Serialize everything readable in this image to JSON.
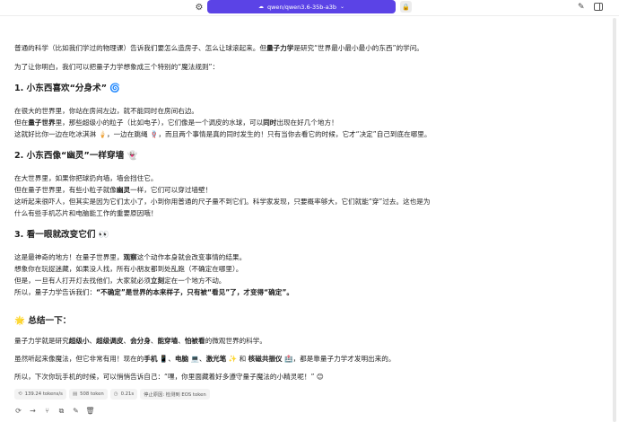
{
  "topbar": {
    "model_name": "qwen/qwen3.6-35b-a3b",
    "gear_icon": "gear-icon",
    "lock_icon": "lock-icon"
  },
  "message": {
    "intro_1a": "普通的科学（比如我们学过的物理课）告诉我们要怎么造房子、怎么让球滚起来。但",
    "intro_1b": "量子力学",
    "intro_1c": "是研究“世界最小最小最小的东西”的学问。",
    "intro_2": "为了让你明白，我们可以把量子力学想象成三个特别的“魔法规则”：",
    "s1_title": "1. 小东西喜欢“分身术”",
    "s1_emoji": "🌀",
    "s1_l1": "在很大的世界里，你站在房间左边，就不能同时在房间右边。",
    "s1_l2a": "但在",
    "s1_l2b": "量子世界",
    "s1_l2c": "里，那些超级小的粒子（比如电子），它们像是一个调皮的水球，可以",
    "s1_l2d": "同时",
    "s1_l2e": "出现在好几个地方！",
    "s1_l3": "这就好比你一边在吃冰淇淋 🍦，一边在跳绳 🪢，而且两个事情是真的同时发生的！只有当你去看它的时候，它才“决定”自己到底在哪里。",
    "s2_title": "2. 小东西像“幽灵”一样穿墙",
    "s2_emoji": "👻",
    "s2_l1": "在大世界里，如果你把球扔向墙，墙会挡住它。",
    "s2_l2a": "但在量子世界里，有些小粒子就像",
    "s2_l2b": "幽灵",
    "s2_l2c": "一样，它们可以穿过墙壁！",
    "s2_l3": "这听起来很吓人，但其实是因为它们太小了，小到你用普通的尺子量不到它们。科学家发现，只要概率够大，它们就能“穿”过去。这也是为",
    "s2_l4": "什么有些手机芯片和电脑能工作的重要原因哦！",
    "s3_title": "3. 看一眼就改变它们",
    "s3_emoji": "👀",
    "s3_l1a": "这是最神奇的地方！在量子世界里，",
    "s3_l1b": "观察",
    "s3_l1c": "这个动作本身就会改变事情的结果。",
    "s3_l2": "想象你在玩捉迷藏，如果没人找，所有小朋友都到处乱跑（不确定在哪里）。",
    "s3_l3a": "但是，一旦有人打开灯去找他们，大家就必须",
    "s3_l3b": "立刻",
    "s3_l3c": "定在一个地方不动。",
    "s3_l4a": "所以，量子力学告诉我们：",
    "s3_l4b": "“不确定”是世界的本来样子，只有被“看见”了，才变得“确定”。",
    "sum_title": "总结一下：",
    "sum_emoji": "🌟",
    "sum_l1a": "量子力学就是研究",
    "sum_l1b": "超级小",
    "sum_l1c": "、",
    "sum_l1d": "超级调皮",
    "sum_l1e": "、",
    "sum_l1f": "会分身",
    "sum_l1g": "、",
    "sum_l1h": "能穿墙",
    "sum_l1i": "、",
    "sum_l1j": "怕被看",
    "sum_l1k": "的微观世界的科学。",
    "sum_l2a": "虽然听起来像魔法，但它非常有用！现在的",
    "sum_l2b": "手机",
    "sum_l2c": " 📱、",
    "sum_l2d": "电脑",
    "sum_l2e": " 💻、",
    "sum_l2f": "激光笔",
    "sum_l2g": " ✨ 和 ",
    "sum_l2h": "核磁共振仪",
    "sum_l2i": " 🏥，都是靠量子力学才发明出来的。",
    "sum_l3": "所以，下次你玩手机的时候，可以悄悄告诉自己：“嘿，你里面藏着好多遵守量子魔法的小精灵呢！” 😊"
  },
  "stats": {
    "speed": "139.24 tokens/s",
    "tokens": "508 token",
    "time": "0.21s",
    "stop_reason": "停止原因: 检测到 EOS token"
  }
}
